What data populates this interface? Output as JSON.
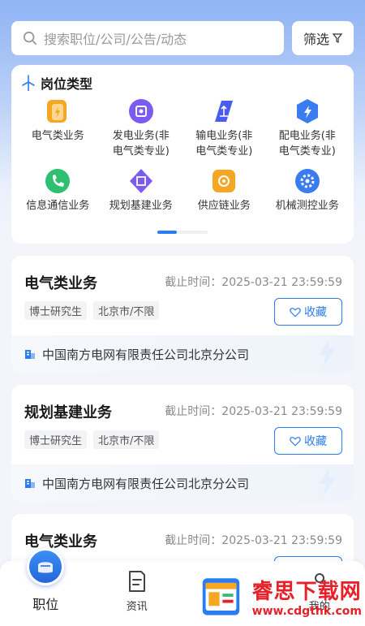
{
  "search": {
    "placeholder": "搜索职位/公司/公告/动态",
    "filter_label": "筛选"
  },
  "categories": {
    "title": "岗位类型",
    "items": [
      {
        "label": "电气类业务",
        "icon": "battery-icon",
        "color": "#f5a623"
      },
      {
        "label": "发电业务(非\n电气类专业)",
        "icon": "power-gen-icon",
        "color": "#7c5cf0"
      },
      {
        "label": "输电业务(非\n电气类专业)",
        "icon": "transmission-icon",
        "color": "#4a5cf0"
      },
      {
        "label": "配电业务(非\n电气类专业)",
        "icon": "distribution-icon",
        "color": "#3a7cf0"
      },
      {
        "label": "信息通信业务",
        "icon": "phone-icon",
        "color": "#2fbf71"
      },
      {
        "label": "规划基建业务",
        "icon": "planning-icon",
        "color": "#7c5cf0"
      },
      {
        "label": "供应链业务",
        "icon": "supply-chain-icon",
        "color": "#f5a623"
      },
      {
        "label": "机械测控业务",
        "icon": "gear-icon",
        "color": "#3a7cf0"
      }
    ]
  },
  "jobs": [
    {
      "title": "电气类业务",
      "deadline": "截止时间：2025-03-21 23:59:59",
      "tags": [
        "博士研究生",
        "北京市/不限"
      ],
      "fav_label": "收藏",
      "company": "中国南方电网有限责任公司北京分公司"
    },
    {
      "title": "规划基建业务",
      "deadline": "截止时间：2025-03-21 23:59:59",
      "tags": [
        "博士研究生",
        "北京市/不限"
      ],
      "fav_label": "收藏",
      "company": "中国南方电网有限责任公司北京分公司"
    },
    {
      "title": "电气类业务",
      "deadline": "截止时间：2025-03-21 23:59:59",
      "tags": [
        "",
        ""
      ],
      "fav_label": "",
      "company": ""
    }
  ],
  "tabbar": {
    "jobs": "职位",
    "news": "资讯",
    "mine": "我的"
  },
  "watermark": {
    "name": "睿思下载网",
    "url": "www.cdgthk.com"
  },
  "colors": {
    "accent": "#2a7cf0"
  }
}
